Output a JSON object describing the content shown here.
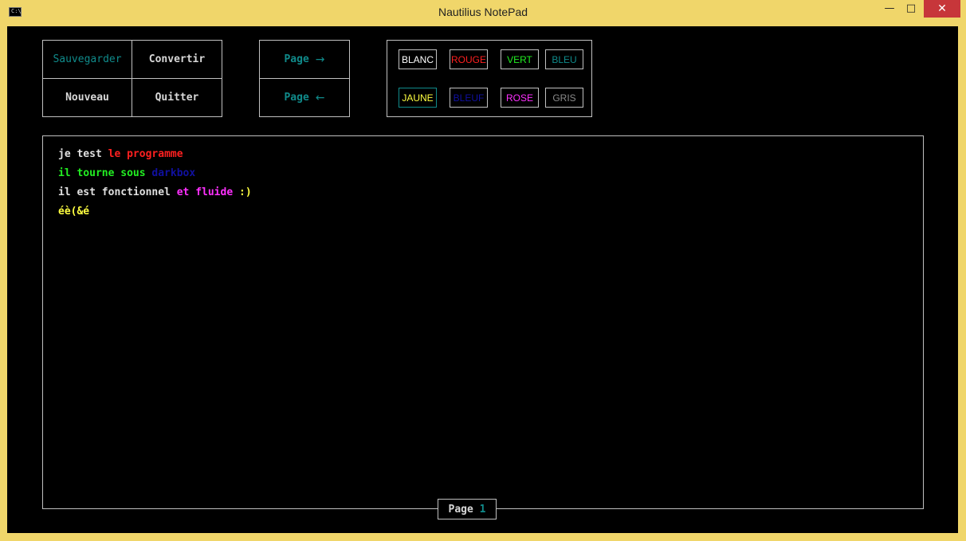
{
  "window": {
    "title": "Nautilius NotePad",
    "icon_label": "C:\\",
    "minimize": "—",
    "maximize": "□",
    "close": "✕"
  },
  "menu": {
    "save": "Sauvegarder",
    "convert": "Convertir",
    "new": "Nouveau",
    "quit": "Quitter"
  },
  "paging": {
    "next_label": "Page",
    "prev_label": "Page",
    "next_icon": "arrow-right-icon",
    "prev_icon": "arrow-left-icon"
  },
  "colors": [
    {
      "label": "BLANC",
      "color": "#ffffff"
    },
    {
      "label": "ROUGE",
      "color": "#ff2020"
    },
    {
      "label": "VERT",
      "color": "#22ee22"
    },
    {
      "label": "BLEU",
      "color": "#108b8b"
    },
    {
      "label": "JAUNE",
      "color": "#ffff40"
    },
    {
      "label": "BLEUF",
      "color": "#1010a0"
    },
    {
      "label": "ROSE",
      "color": "#ff30ff"
    },
    {
      "label": "GRIS",
      "color": "#8a8a8a"
    }
  ],
  "editor": {
    "lines": [
      [
        {
          "text": "je test ",
          "color": "#e0e0e0"
        },
        {
          "text": "le programme",
          "color": "#ff2020"
        }
      ],
      [
        {
          "text": "il tourne sous ",
          "color": "#22ee22"
        },
        {
          "text": "darkbox",
          "color": "#1010a0"
        }
      ],
      [
        {
          "text": "il est fonctionnel ",
          "color": "#e0e0e0"
        },
        {
          "text": "et fluide ",
          "color": "#ff30ff"
        },
        {
          "text": ":)",
          "color": "#ffff40"
        }
      ],
      [
        {
          "text": "éè(&é",
          "color": "#ffff40"
        }
      ]
    ]
  },
  "footer": {
    "page_label": "Page",
    "page_number": "1"
  }
}
